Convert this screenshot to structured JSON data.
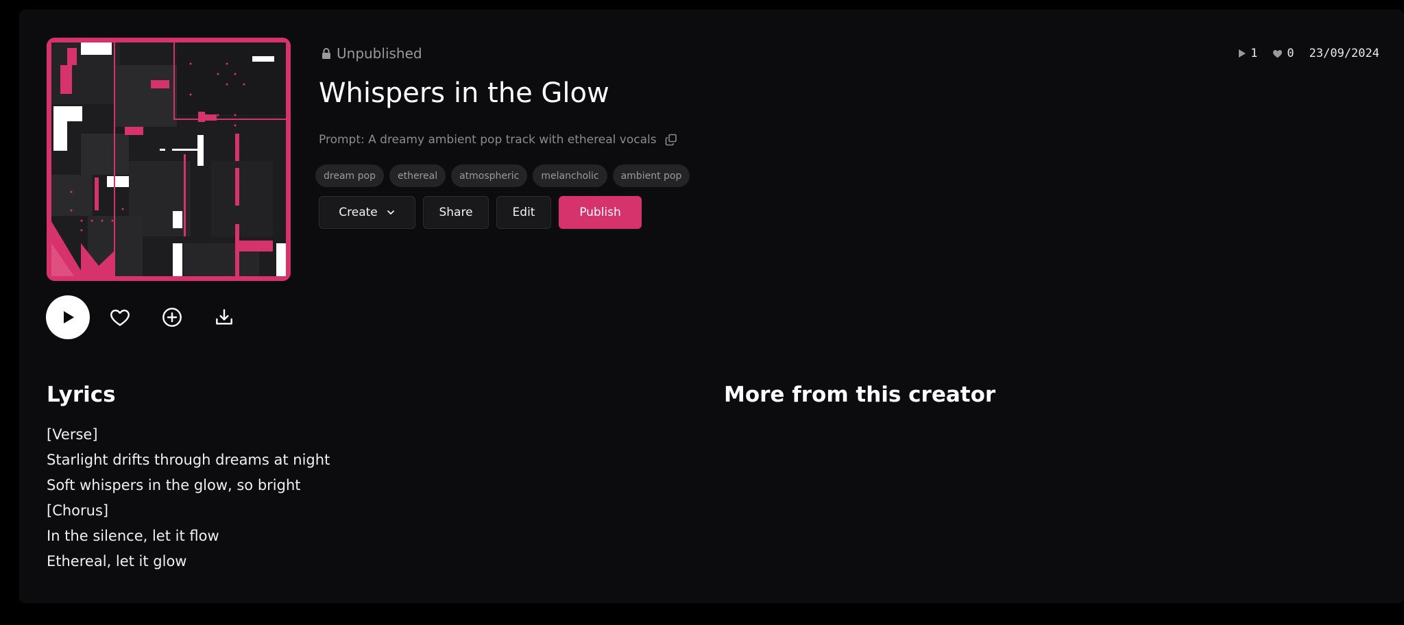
{
  "song": {
    "status": "Unpublished",
    "title": "Whispers in the Glow",
    "prompt": "Prompt: A dreamy ambient pop track with ethereal vocals",
    "tags": [
      "dream pop",
      "ethereal",
      "atmospheric",
      "melancholic",
      "ambient pop"
    ],
    "plays": "1",
    "likes": "0",
    "date": "23/09/2024"
  },
  "actions": {
    "create": "Create",
    "share": "Share",
    "edit": "Edit",
    "publish": "Publish"
  },
  "icons": {
    "status": "lock-icon",
    "copy": "copy-icon",
    "create_dropdown": "chevron-down-icon",
    "play": "play-icon",
    "like": "heart-icon",
    "add": "plus-circle-icon",
    "download": "download-icon",
    "plays": "play-icon",
    "likes": "heart-icon"
  },
  "lyrics": {
    "heading": "Lyrics",
    "lines": [
      "[Verse]",
      "Starlight drifts through dreams at night",
      "Soft whispers in the glow, so bright",
      "[Chorus]",
      "In the silence, let it flow",
      "Ethereal, let it glow"
    ]
  },
  "more": {
    "heading": "More from this creator"
  },
  "colors": {
    "accent": "#d6336c",
    "background": "#0c0c0e",
    "tag_background": "#242427",
    "button_background": "#19191c"
  }
}
